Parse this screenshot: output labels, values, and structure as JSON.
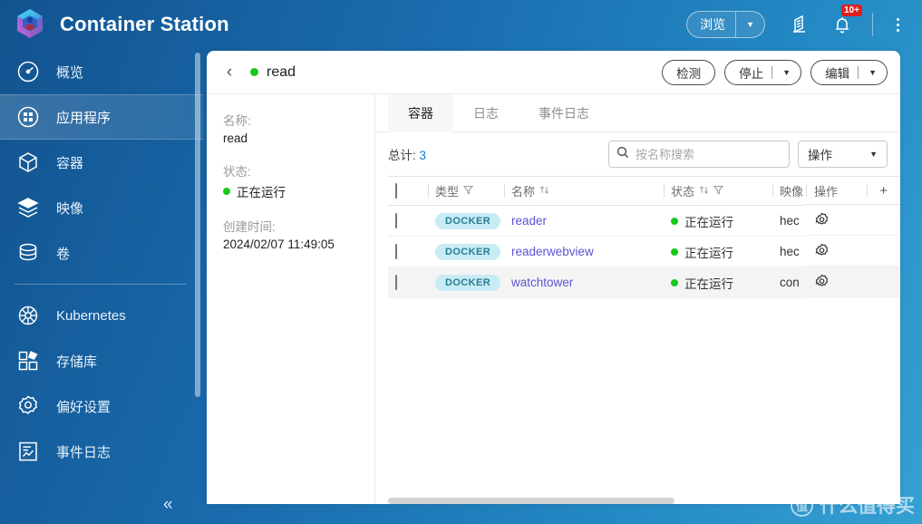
{
  "header": {
    "title": "Container Station",
    "logo_icon": "container-station-logo",
    "browse_button": {
      "label": "浏览",
      "caret": "▼"
    },
    "icons": [
      {
        "name": "help-guide-icon"
      },
      {
        "name": "notification-bell-icon",
        "badge": "10+"
      },
      {
        "name": "more-options-icon"
      }
    ]
  },
  "sidebar": {
    "items": [
      {
        "label": "概览",
        "icon": "dashboard-icon",
        "active": false
      },
      {
        "label": "应用程序",
        "icon": "applications-icon",
        "active": true
      },
      {
        "label": "容器",
        "icon": "container-cube-icon",
        "active": false
      },
      {
        "label": "映像",
        "icon": "images-layers-icon",
        "active": false
      },
      {
        "label": "卷",
        "icon": "volume-database-icon",
        "active": false
      }
    ],
    "items2": [
      {
        "label": "Kubernetes",
        "icon": "kubernetes-helm-icon",
        "active": false
      },
      {
        "label": "存储库",
        "icon": "registry-icon",
        "active": false
      },
      {
        "label": "偏好设置",
        "icon": "preferences-gear-icon",
        "active": false
      },
      {
        "label": "事件日志",
        "icon": "event-log-icon",
        "active": false
      }
    ],
    "collapse_label": "«"
  },
  "panel": {
    "back_icon": "back-chevron-icon",
    "status_dot_color": "#19c819",
    "title": "read",
    "actions": [
      {
        "label": "检测",
        "split": false
      },
      {
        "label": "停止",
        "split": true,
        "caret": "▼"
      },
      {
        "label": "编辑",
        "split": true,
        "caret": "▼"
      }
    ],
    "info": {
      "name_label": "名称:",
      "name_value": "read",
      "status_label": "状态:",
      "status_value": "正在运行",
      "created_label": "创建时间:",
      "created_value": "2024/02/07 11:49:05"
    },
    "tabs": [
      {
        "label": "容器",
        "active": true
      },
      {
        "label": "日志",
        "active": false
      },
      {
        "label": "事件日志",
        "active": false
      }
    ],
    "toolbar": {
      "total_label": "总计:",
      "total_value": "3",
      "search_placeholder": "按名称搜索",
      "search_value": "",
      "search_icon": "search-icon",
      "operations_label": "操作",
      "operations_caret": "▼"
    },
    "table": {
      "columns": [
        {
          "key": "check",
          "label": ""
        },
        {
          "key": "type",
          "label": "类型",
          "filter": true,
          "sort": false
        },
        {
          "key": "name",
          "label": "名称",
          "filter": false,
          "sort": true
        },
        {
          "key": "status",
          "label": "状态",
          "filter": true,
          "sort": true
        },
        {
          "key": "image",
          "label": "映像",
          "filter": false,
          "sort": false
        }
      ],
      "op_column_label": "操作",
      "add_column_label": "+",
      "rows": [
        {
          "type": "DOCKER",
          "name": "reader",
          "status": "正在运行",
          "image": "hec",
          "action_icon": "gear-icon",
          "highlight": false
        },
        {
          "type": "DOCKER",
          "name": "readerwebview",
          "status": "正在运行",
          "image": "hec",
          "action_icon": "gear-icon",
          "highlight": false
        },
        {
          "type": "DOCKER",
          "name": "watchtower",
          "status": "正在运行",
          "image": "con",
          "action_icon": "gear-icon",
          "highlight": true
        }
      ]
    }
  },
  "watermark": {
    "mark": "值",
    "text": "什么值得买"
  }
}
